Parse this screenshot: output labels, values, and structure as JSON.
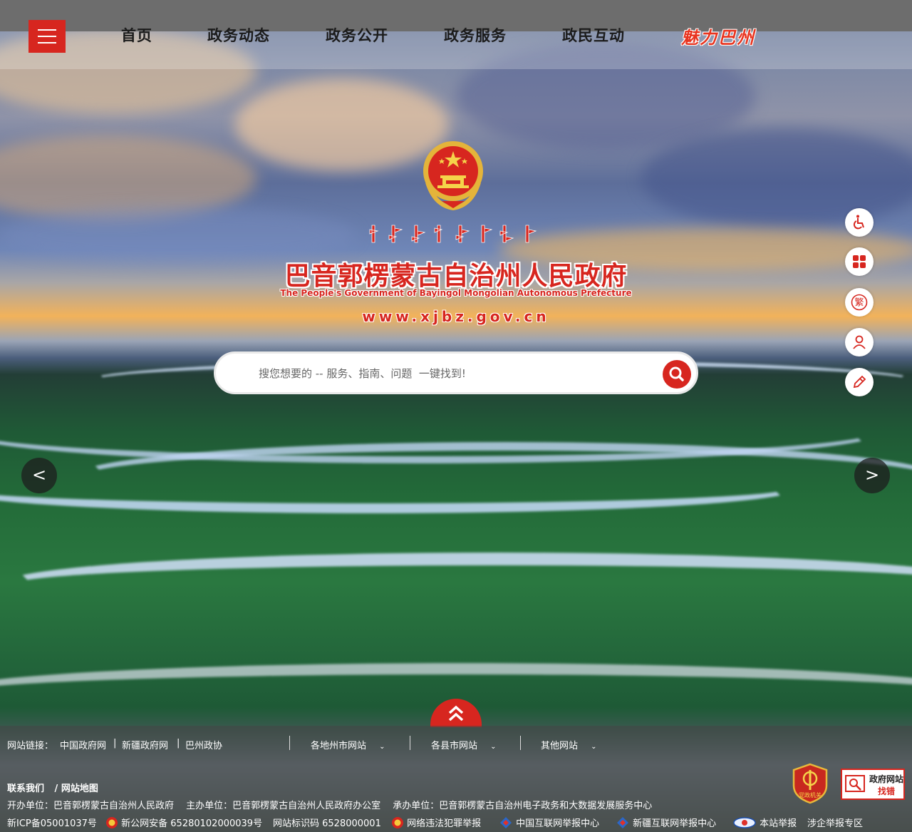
{
  "nav": {
    "items": [
      "首页",
      "政务动态",
      "政务公开",
      "政务服务",
      "政民互动"
    ],
    "special": "魅力巴州"
  },
  "header": {
    "title_cn": "巴音郭楞蒙古自治州人民政府",
    "title_en": "The People's Government of Bayingol Mongolian Autonomous Prefecture",
    "url": "www.xjbz.gov.cn"
  },
  "search": {
    "placeholder": "搜您想要的 -- 服务、指南、问题  一键找到!"
  },
  "carousel": {
    "prev": "<",
    "next": ">"
  },
  "side_tools": [
    {
      "icon": "accessibility-icon"
    },
    {
      "icon": "apps-grid-icon"
    },
    {
      "icon": "traditional-chinese-icon",
      "label": "繁"
    },
    {
      "icon": "user-icon"
    },
    {
      "icon": "edit-icon"
    }
  ],
  "footer": {
    "links_label": "网站链接：",
    "links": [
      "中国政府网",
      "新疆政府网",
      "巴州政协"
    ],
    "dropdowns": [
      "各地州市网站",
      "各县市网站",
      "其他网站"
    ],
    "contact": "联系我们",
    "sitemap": "/ 网站地图",
    "info": "开办单位：巴音郭楞蒙古自治州人民政府　 主办单位：巴音郭楞蒙古自治州人民政府办公室　 承办单位：巴音郭楞蒙古自治州电子政务和大数据发展服务中心",
    "icp": "新ICP备05001037号",
    "police": "新公网安备 65280102000039号",
    "site_code": "网站标识码 6528000001",
    "report1": "网络违法犯罪举报",
    "report2": "中国互联网举报中心",
    "report3": "新疆互联网举报中心",
    "report4": "本站举报",
    "report5": "涉企举报专区",
    "badge_party": "党政机关",
    "badge_gov_line1": "政府网站",
    "badge_gov_line2": "找错"
  }
}
